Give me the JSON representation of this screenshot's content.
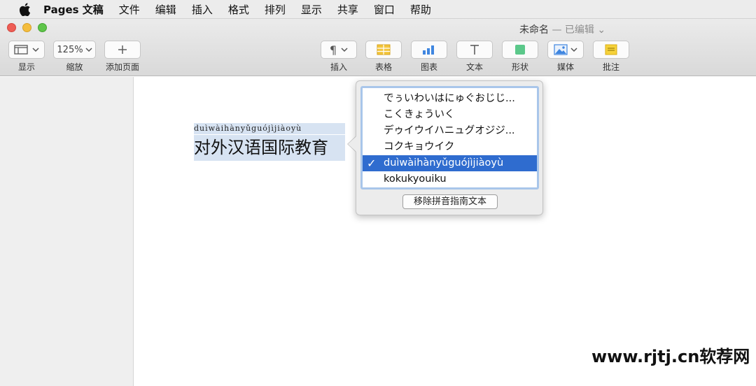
{
  "menubar": {
    "items": [
      "Pages 文稿",
      "文件",
      "编辑",
      "插入",
      "格式",
      "排列",
      "显示",
      "共享",
      "窗口",
      "帮助"
    ]
  },
  "window": {
    "title": "未命名",
    "status": "— 已编辑"
  },
  "toolbar": {
    "view_label": "显示",
    "zoom_value": "125%",
    "zoom_label": "缩放",
    "add_page_label": "添加页面",
    "insert_label": "插入",
    "table_label": "表格",
    "chart_label": "图表",
    "text_label": "文本",
    "shape_label": "形状",
    "media_label": "媒体",
    "comment_label": "批注"
  },
  "document": {
    "ruby_text": "duìwàihànyǔguójìjiàoyù",
    "main_text": "对外汉语国际教育"
  },
  "popover": {
    "options": [
      "でぅいわいはにゅぐおじじ...",
      "こくきょういく",
      "デゥイウイハニュグオジジ...",
      "コクキョウイク",
      "duìwàihànyǔguójìjiàoyù",
      "kokukyouiku"
    ],
    "selected_index": 4,
    "check_mark": "✓",
    "remove_button": "移除拼音指南文本"
  },
  "watermark": "www.rjtj.cn软荐网",
  "colors": {
    "selection_highlight": "#d7e3f2",
    "list_selected": "#2f6ccf",
    "list_focus_ring": "#a9c6ea"
  }
}
